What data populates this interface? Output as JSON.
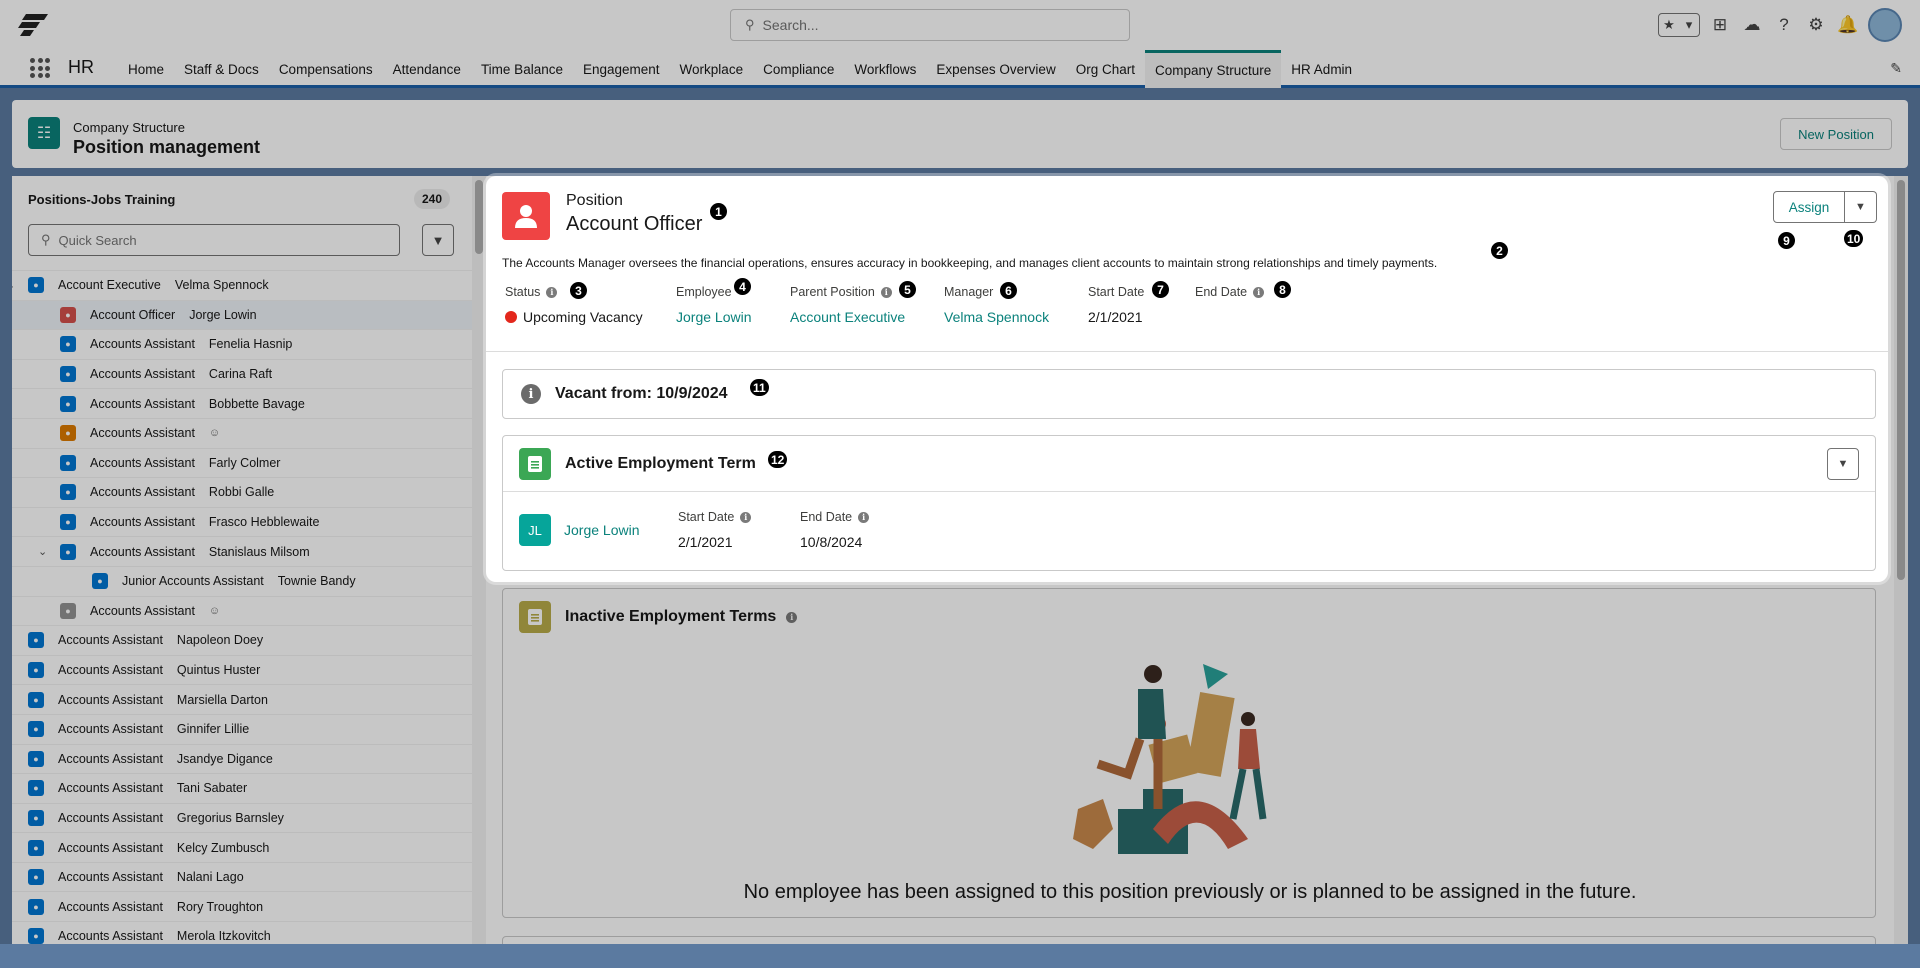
{
  "global": {
    "search_placeholder": "Search...",
    "app_name": "HR",
    "nav": [
      "Home",
      "Staff & Docs",
      "Compensations",
      "Attendance",
      "Time Balance",
      "Engagement",
      "Workplace",
      "Compliance",
      "Workflows",
      "Expenses Overview",
      "Org Chart",
      "Company Structure",
      "HR Admin"
    ],
    "active_nav": "Company Structure"
  },
  "page": {
    "subtitle": "Company Structure",
    "title": "Position management",
    "new_position_label": "New Position"
  },
  "left_panel": {
    "title": "Positions-Jobs Training",
    "count": "240",
    "search_placeholder": "Quick Search",
    "rows": [
      {
        "title": "Account Executive",
        "person": "Velma Spennock",
        "icon": "blue",
        "indent": 0,
        "chev": "down"
      },
      {
        "title": "Account Officer",
        "person": "Jorge Lowin",
        "icon": "red",
        "indent": 1,
        "selected": true
      },
      {
        "title": "Accounts Assistant",
        "person": "Fenelia Hasnip",
        "icon": "blue",
        "indent": 1
      },
      {
        "title": "Accounts Assistant",
        "person": "Carina Raft",
        "icon": "blue",
        "indent": 1
      },
      {
        "title": "Accounts Assistant",
        "person": "Bobbette Bavage",
        "icon": "blue",
        "indent": 1
      },
      {
        "title": "Accounts Assistant",
        "person": "",
        "icon": "orange",
        "indent": 1,
        "vacant": true
      },
      {
        "title": "Accounts Assistant",
        "person": "Farly Colmer",
        "icon": "blue",
        "indent": 1
      },
      {
        "title": "Accounts Assistant",
        "person": "Robbi Galle",
        "icon": "blue",
        "indent": 1
      },
      {
        "title": "Accounts Assistant",
        "person": "Frasco Hebblewaite",
        "icon": "blue",
        "indent": 1
      },
      {
        "title": "Accounts Assistant",
        "person": "Stanislaus Milsom",
        "icon": "blue",
        "indent": 1,
        "chev": "down"
      },
      {
        "title": "Junior Accounts Assistant",
        "person": "Townie Bandy",
        "icon": "blue",
        "indent": 2
      },
      {
        "title": "Accounts Assistant",
        "person": "",
        "icon": "grey",
        "indent": 1,
        "vacant": true
      },
      {
        "title": "Accounts Assistant",
        "person": "Napoleon Doey",
        "icon": "blue",
        "indent": 0
      },
      {
        "title": "Accounts Assistant",
        "person": "Quintus Huster",
        "icon": "blue",
        "indent": 0
      },
      {
        "title": "Accounts Assistant",
        "person": "Marsiella Darton",
        "icon": "blue",
        "indent": 0
      },
      {
        "title": "Accounts Assistant",
        "person": "Ginnifer Lillie",
        "icon": "blue",
        "indent": 0
      },
      {
        "title": "Accounts Assistant",
        "person": "Jsandye Digance",
        "icon": "blue",
        "indent": 0
      },
      {
        "title": "Accounts Assistant",
        "person": "Tani Sabater",
        "icon": "blue",
        "indent": 0
      },
      {
        "title": "Accounts Assistant",
        "person": "Gregorius Barnsley",
        "icon": "blue",
        "indent": 0
      },
      {
        "title": "Accounts Assistant",
        "person": "Kelcy Zumbusch",
        "icon": "blue",
        "indent": 0
      },
      {
        "title": "Accounts Assistant",
        "person": "Nalani Lago",
        "icon": "blue",
        "indent": 0
      },
      {
        "title": "Accounts Assistant",
        "person": "Rory Troughton",
        "icon": "blue",
        "indent": 0
      },
      {
        "title": "Accounts Assistant",
        "person": "Merola Itzkovitch",
        "icon": "blue",
        "indent": 0
      }
    ]
  },
  "detail": {
    "label": "Position",
    "name": "Account Officer",
    "description": "The Accounts Manager oversees the financial operations, ensures accuracy in bookkeeping, and manages client accounts to maintain strong relationships and timely payments.",
    "assign_label": "Assign",
    "fields": {
      "status_label": "Status",
      "status_value": "Upcoming Vacancy",
      "employee_label": "Employee",
      "employee_value": "Jorge Lowin",
      "parent_label": "Parent Position",
      "parent_value": "Account Executive",
      "manager_label": "Manager",
      "manager_value": "Velma Spennock",
      "start_label": "Start Date",
      "start_value": "2/1/2021",
      "end_label": "End Date"
    },
    "vacant_text": "Vacant from: 10/9/2024",
    "active_term": {
      "title": "Active Employment Term",
      "initials": "JL",
      "employee": "Jorge Lowin",
      "start_label": "Start Date",
      "start_value": "2/1/2021",
      "end_label": "End Date",
      "end_value": "10/8/2024"
    },
    "inactive_term": {
      "title": "Inactive Employment Terms",
      "empty_message": "No employee has been assigned to this position previously or is planned to be assigned in the future."
    }
  },
  "badges": [
    "1",
    "2",
    "3",
    "4",
    "5",
    "6",
    "7",
    "8",
    "9",
    "10",
    "11",
    "12"
  ]
}
